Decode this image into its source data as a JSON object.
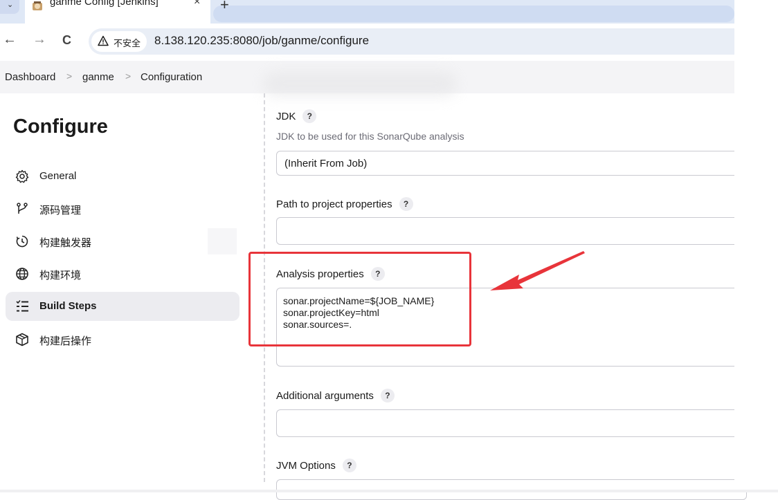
{
  "browser": {
    "tab_title": "ganme Config [Jenkins]",
    "tab_close": "×",
    "new_tab": "+",
    "tab_dropdown": "⌄",
    "back": "←",
    "forward": "→",
    "reload": "C",
    "security_label": "不安全",
    "url": "8.138.120.235:8080/job/ganme/configure"
  },
  "breadcrumb": {
    "items": [
      "Dashboard",
      "ganme",
      "Configuration"
    ],
    "separator": ">"
  },
  "sidebar": {
    "title": "Configure",
    "items": [
      {
        "label": "General",
        "icon": "gear-icon"
      },
      {
        "label": "源码管理",
        "icon": "source-branch-icon"
      },
      {
        "label": "构建触发器",
        "icon": "timer-icon"
      },
      {
        "label": "构建环境",
        "icon": "globe-icon"
      },
      {
        "label": "Build Steps",
        "icon": "list-icon",
        "active": true
      },
      {
        "label": "构建后操作",
        "icon": "package-icon"
      }
    ]
  },
  "form": {
    "help_label": "?",
    "jdk": {
      "label": "JDK",
      "description": "JDK to be used for this SonarQube analysis",
      "value": "(Inherit From Job)"
    },
    "path_to_project_properties": {
      "label": "Path to project properties",
      "value": ""
    },
    "analysis_properties": {
      "label": "Analysis properties",
      "lines": [
        "sonar.projectName=${JOB_NAME}",
        "sonar.projectKey=html",
        "sonar.sources=."
      ]
    },
    "additional_arguments": {
      "label": "Additional arguments",
      "value": ""
    },
    "jvm_options": {
      "label": "JVM Options"
    }
  },
  "colors": {
    "annotation_red": "#e8343a",
    "sidebar_active": "#ececf0"
  }
}
